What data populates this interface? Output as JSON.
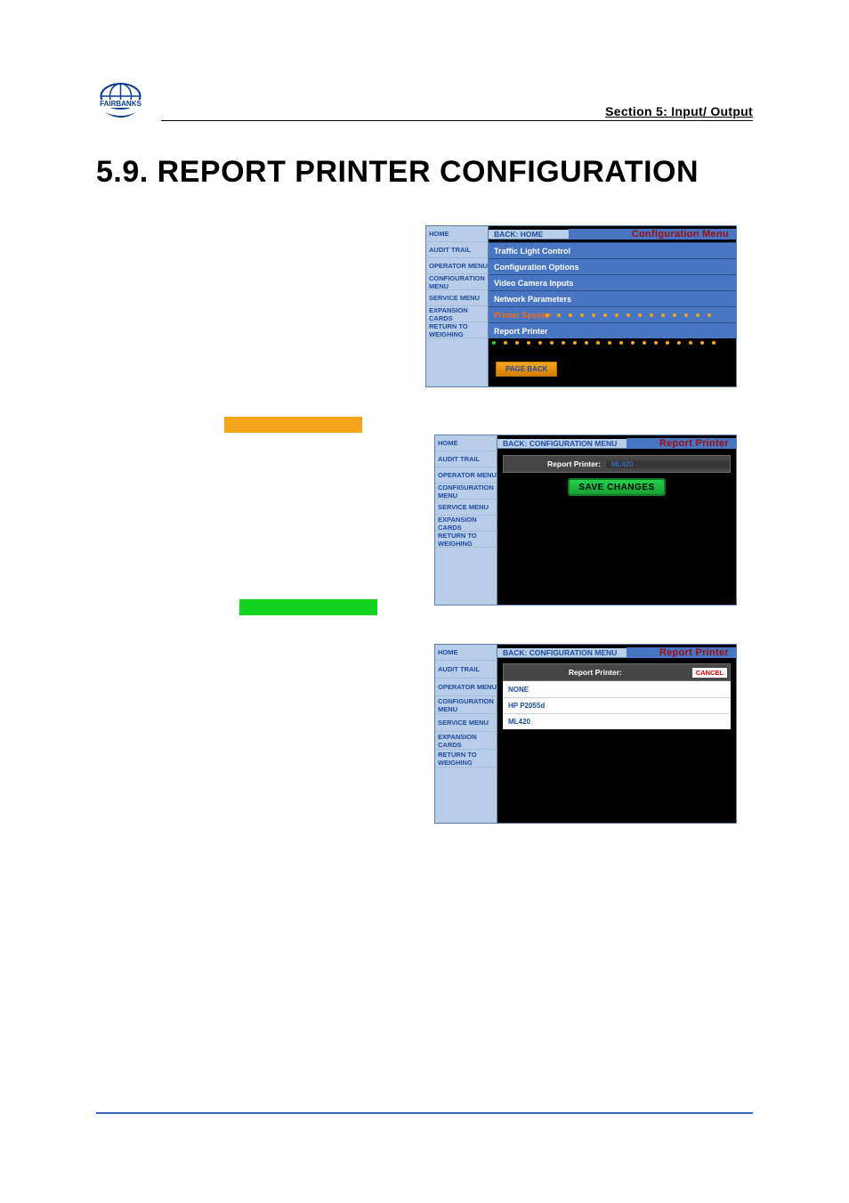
{
  "header": {
    "section": "Section 5: Input/ Output"
  },
  "title": "5.9.  REPORT PRINTER CONFIGURATION",
  "sidebar": {
    "items": [
      "HOME",
      "AUDIT TRAIL",
      "OPERATOR MENU",
      "CONFIGURATION MENU",
      "SERVICE MENU",
      "EXPANSION CARDS",
      "RETURN TO WEIGHING"
    ]
  },
  "panel1": {
    "crumb": "BACK: HOME",
    "title": "Configuration Menu",
    "menu": [
      "Traffic Light Control",
      "Configuration Options",
      "Video Camera Inputs",
      "Network Parameters",
      "Printer Spooler",
      "Report Printer"
    ],
    "page_back": "PAGE BACK"
  },
  "panel2": {
    "crumb": "BACK: CONFIGURATION MENU",
    "title": "Report Printer",
    "report_printer_label": "Report Printer:",
    "report_printer_value": "ML420",
    "save": "SAVE CHANGES"
  },
  "panel3": {
    "crumb": "BACK: CONFIGURATION MENU",
    "title": "Report Printer",
    "report_printer_label": "Report Printer:",
    "cancel": "CANCEL",
    "options": [
      "NONE",
      "HP P2055d",
      "ML420"
    ]
  }
}
